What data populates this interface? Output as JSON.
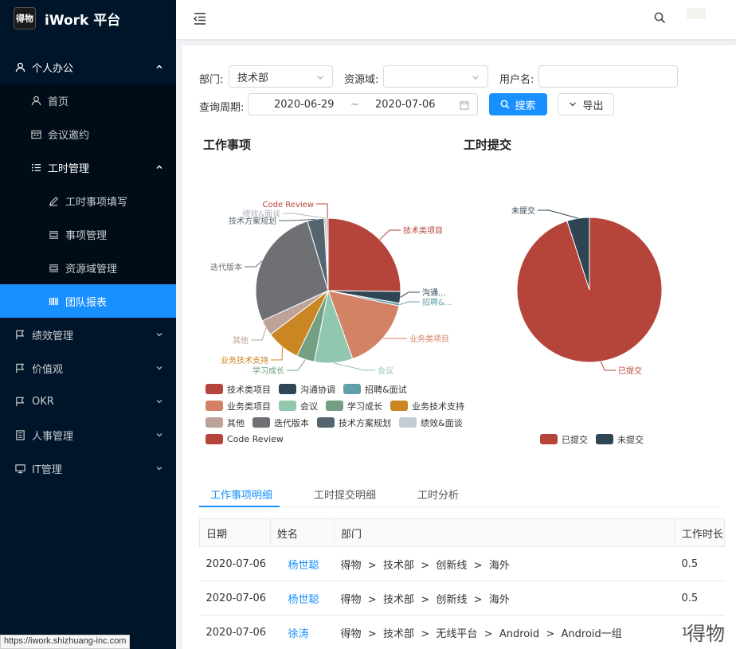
{
  "brand": {
    "logo_text": "得物",
    "title": "iWork 平台"
  },
  "sidebar": {
    "group_personal": "个人办公",
    "home": "首页",
    "meeting": "会议邀约",
    "worktime": "工时管理",
    "worktime_fill": "工时事项填写",
    "item_manage": "事项管理",
    "domain_manage": "资源域管理",
    "team_report": "团队报表",
    "performance": "绩效管理",
    "values": "价值观",
    "okr": "OKR",
    "hr": "人事管理",
    "it": "IT管理"
  },
  "filters": {
    "dept_label": "部门:",
    "dept_value": "技术部",
    "domain_label": "资源域:",
    "domain_value": "",
    "user_label": "用户名:",
    "user_value": "",
    "period_label": "查询周期:",
    "date_start": "2020-06-29",
    "date_sep": "~",
    "date_end": "2020-07-06",
    "search_btn": "搜索",
    "export_btn": "导出"
  },
  "charts_titles": {
    "left": "工作事项",
    "right": "工时提交"
  },
  "chart_data": [
    {
      "type": "pie",
      "title": "工作事项",
      "slices": [
        {
          "name": "技术类项目",
          "value": 25,
          "color": "#b5453a",
          "label": "技术类项目"
        },
        {
          "name": "沟通协调",
          "value": 2.6,
          "color": "#2f4554",
          "label": "沟通..."
        },
        {
          "name": "招聘&面试",
          "value": 0.6,
          "color": "#61a0a8",
          "label": "招聘&..."
        },
        {
          "name": "业务类项目",
          "value": 16,
          "color": "#d48265",
          "label": "业务类项目"
        },
        {
          "name": "会议",
          "value": 8.5,
          "color": "#91c7ae",
          "label": "会议"
        },
        {
          "name": "学习成长",
          "value": 4,
          "color": "#749f83",
          "label": "学习成长"
        },
        {
          "name": "业务技术支持",
          "value": 7.5,
          "color": "#ca8622",
          "label": "业务技术支持"
        },
        {
          "name": "其他",
          "value": 3.5,
          "color": "#bda29a",
          "label": "其他"
        },
        {
          "name": "迭代版本",
          "value": 27,
          "color": "#6e7074",
          "label": "迭代版本"
        },
        {
          "name": "技术方案规划",
          "value": 3.7,
          "color": "#546570",
          "label": "技术方案规划"
        },
        {
          "name": "绩效&面谈",
          "value": 0.6,
          "color": "#c4ccd3",
          "label": "绩效&面谈"
        },
        {
          "name": "Code Review",
          "value": 0.3,
          "color": "#b5453a",
          "label": "Code Review"
        }
      ],
      "legend_rows": [
        [
          "技术类项目",
          "沟通协调",
          "招聘&面试"
        ],
        [
          "业务类项目",
          "会议",
          "学习成长",
          "业务技术支持"
        ],
        [
          "其他",
          "迭代版本",
          "技术方案规划",
          "绩效&面谈"
        ],
        [
          "Code Review"
        ]
      ]
    },
    {
      "type": "pie",
      "title": "工时提交",
      "slices": [
        {
          "name": "已提交",
          "value": 95,
          "color": "#b5453a",
          "label": "已提交"
        },
        {
          "name": "未提交",
          "value": 5,
          "color": "#2f4554",
          "label": "未提交"
        }
      ],
      "legend_rows": [
        [
          "已提交",
          "未提交"
        ]
      ]
    }
  ],
  "tabs": {
    "detail": "工作事项明细",
    "submit": "工时提交明细",
    "analysis": "工时分析"
  },
  "table": {
    "headers": {
      "date": "日期",
      "name": "姓名",
      "dept": "部门",
      "hours": "工作时长"
    },
    "rows": [
      {
        "date": "2020-07-06",
        "name": "杨世聪",
        "d1": "得物",
        "d2": "技术部",
        "d3": "创新线",
        "d4": "海外",
        "hours": "0.5"
      },
      {
        "date": "2020-07-06",
        "name": "杨世聪",
        "d1": "得物",
        "d2": "技术部",
        "d3": "创新线",
        "d4": "海外",
        "hours": "0.5"
      },
      {
        "date": "2020-07-06",
        "name": "徐涛",
        "d1": "得物",
        "d2": "技术部",
        "d3": "无线平台",
        "d4": "Android",
        "d5": "Android一组",
        "hours": "1"
      }
    ]
  },
  "status_url": "https://iwork.shizhuang-inc.com",
  "watermark": "得物"
}
